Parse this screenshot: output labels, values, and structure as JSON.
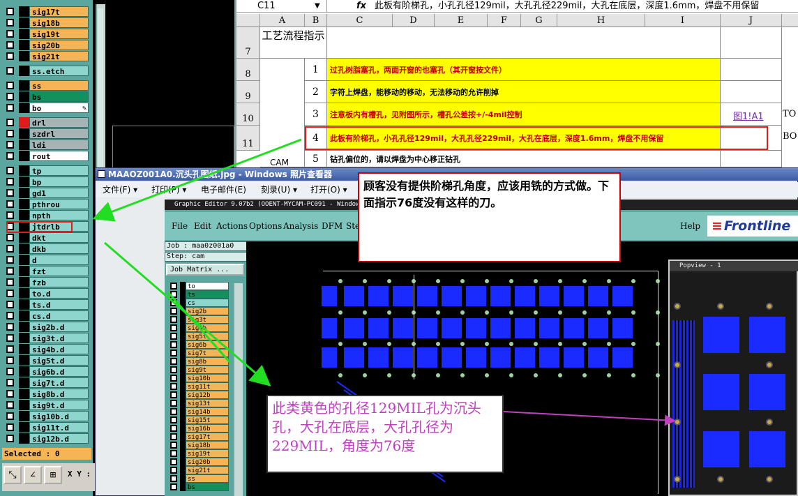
{
  "left_panel": {
    "layers": [
      {
        "name": "sig17t",
        "color": "orange"
      },
      {
        "name": "sig18b",
        "color": "orange"
      },
      {
        "name": "sig19t",
        "color": "orange"
      },
      {
        "name": "sig20b",
        "color": "orange"
      },
      {
        "name": "sig21t",
        "color": "orange"
      },
      {
        "name": "ss.etch",
        "color": "teal"
      },
      {
        "name": "ss",
        "color": "orange"
      },
      {
        "name": "bs",
        "color": "green"
      },
      {
        "name": "bo",
        "color": "white"
      },
      {
        "name": "drl",
        "color": "gray"
      },
      {
        "name": "szdrl",
        "color": "gray"
      },
      {
        "name": "ldi",
        "color": "gray"
      },
      {
        "name": "rout",
        "color": "white"
      },
      {
        "name": "tp",
        "color": "teal"
      },
      {
        "name": "bp",
        "color": "teal"
      },
      {
        "name": "gd1",
        "color": "teal"
      },
      {
        "name": "pthrou",
        "color": "teal"
      },
      {
        "name": "npth",
        "color": "teal"
      },
      {
        "name": "jtdrlb",
        "color": "teal"
      },
      {
        "name": "dkt",
        "color": "teal"
      },
      {
        "name": "dkb",
        "color": "teal"
      },
      {
        "name": "d",
        "color": "teal"
      },
      {
        "name": "fzt",
        "color": "teal"
      },
      {
        "name": "fzb",
        "color": "teal"
      },
      {
        "name": "to.d",
        "color": "teal"
      },
      {
        "name": "ts.d",
        "color": "teal"
      },
      {
        "name": "cs.d",
        "color": "teal"
      },
      {
        "name": "sig2b.d",
        "color": "teal"
      },
      {
        "name": "sig3t.d",
        "color": "teal"
      },
      {
        "name": "sig4b.d",
        "color": "teal"
      },
      {
        "name": "sig5t.d",
        "color": "teal"
      },
      {
        "name": "sig6b.d",
        "color": "teal"
      },
      {
        "name": "sig7t.d",
        "color": "teal"
      },
      {
        "name": "sig8b.d",
        "color": "teal"
      },
      {
        "name": "sig9t.d",
        "color": "teal"
      },
      {
        "name": "sig10b.d",
        "color": "teal"
      },
      {
        "name": "sig11t.d",
        "color": "teal"
      },
      {
        "name": "sig12b.d",
        "color": "teal"
      }
    ],
    "selected_text": "Selected : 0",
    "xy_label": "X Y :"
  },
  "spreadsheet": {
    "name_box": "C11",
    "fx": "fx",
    "formula": "此板有阶梯孔，小孔孔径129mil，大孔孔径229mil，大孔在底层，深度1.6mm，焊盘不用保留",
    "columns": [
      "A",
      "B",
      "C",
      "D",
      "E",
      "F",
      "G",
      "H",
      "I",
      "J"
    ],
    "row_numbers": [
      "7",
      "8",
      "9",
      "10",
      "11"
    ],
    "header_cell": "工艺流程指示",
    "tasks": [
      {
        "no": "1",
        "text": "过孔树脂塞孔，两面开窗的也塞孔（其开窗按文件）",
        "yellow": true,
        "color": "#c00000"
      },
      {
        "no": "2",
        "text": "字符上焊盘，能移动的移动，无法移动的允许削掉",
        "yellow": true,
        "color": "#000000"
      },
      {
        "no": "3",
        "text": "注意板内有槽孔，见附图所示，槽孔公差按+/-4mil控制",
        "yellow": true,
        "color": "#c00000"
      },
      {
        "no": "4",
        "text": "此板有阶梯孔，小孔孔径129mil，大孔孔径229mil，大孔在底层，深度1.6mm，焊盘不用保留",
        "yellow": true,
        "color": "#c00000"
      },
      {
        "no": "5",
        "text": "钻孔偏位的，请以焊盘为中心移正钻孔",
        "yellow": false,
        "color": "#000000"
      }
    ],
    "link_j": "图1!A1",
    "k_to": "TO",
    "k_bo": "BO",
    "cam_label": "CAM"
  },
  "viewer": {
    "title": "MAAOZ001A0.沉头孔图纸.jpg - Windows 照片查看器",
    "menu": [
      "文件(F) ▾",
      "打印(P) ▾",
      "电子邮件(E)",
      "刻录(U) ▾",
      "打开(O) ▾"
    ]
  },
  "graphic_editor": {
    "title": "Graphic Editor 9.07b2 (OOENT-MYCAM-PC091 - Windows",
    "menu": [
      "File",
      "Edit",
      "Actions",
      "Options",
      "Analysis",
      "DFM",
      "Ste"
    ],
    "help": "Help",
    "logo": "Frontline",
    "job": "Job : maa0z001a0",
    "step": "Step: cam",
    "job_matrix": "Job Matrix ...",
    "layers": [
      "to",
      "ts",
      "cs",
      "sig2b",
      "sig3t",
      "sig4b",
      "sig5t",
      "sig6b",
      "sig7t",
      "sig8b",
      "sig9t",
      "sig10b",
      "sig11t",
      "sig12b",
      "sig13t",
      "sig14b",
      "sig15t",
      "sig16b",
      "sig17t",
      "sig18b",
      "sig19t",
      "sig20b",
      "sig21t",
      "ss",
      "bs"
    ]
  },
  "popview": {
    "title": "Popview - 1"
  },
  "callouts": {
    "top": "顾客没有提供阶梯孔角度，应该用铣的方式做。下面指示76度没有这样的刀。",
    "bottom": "此类黄色的孔径129MIL孔为沉头孔，大孔在底层，大孔孔径为229MIL，角度为76度"
  }
}
